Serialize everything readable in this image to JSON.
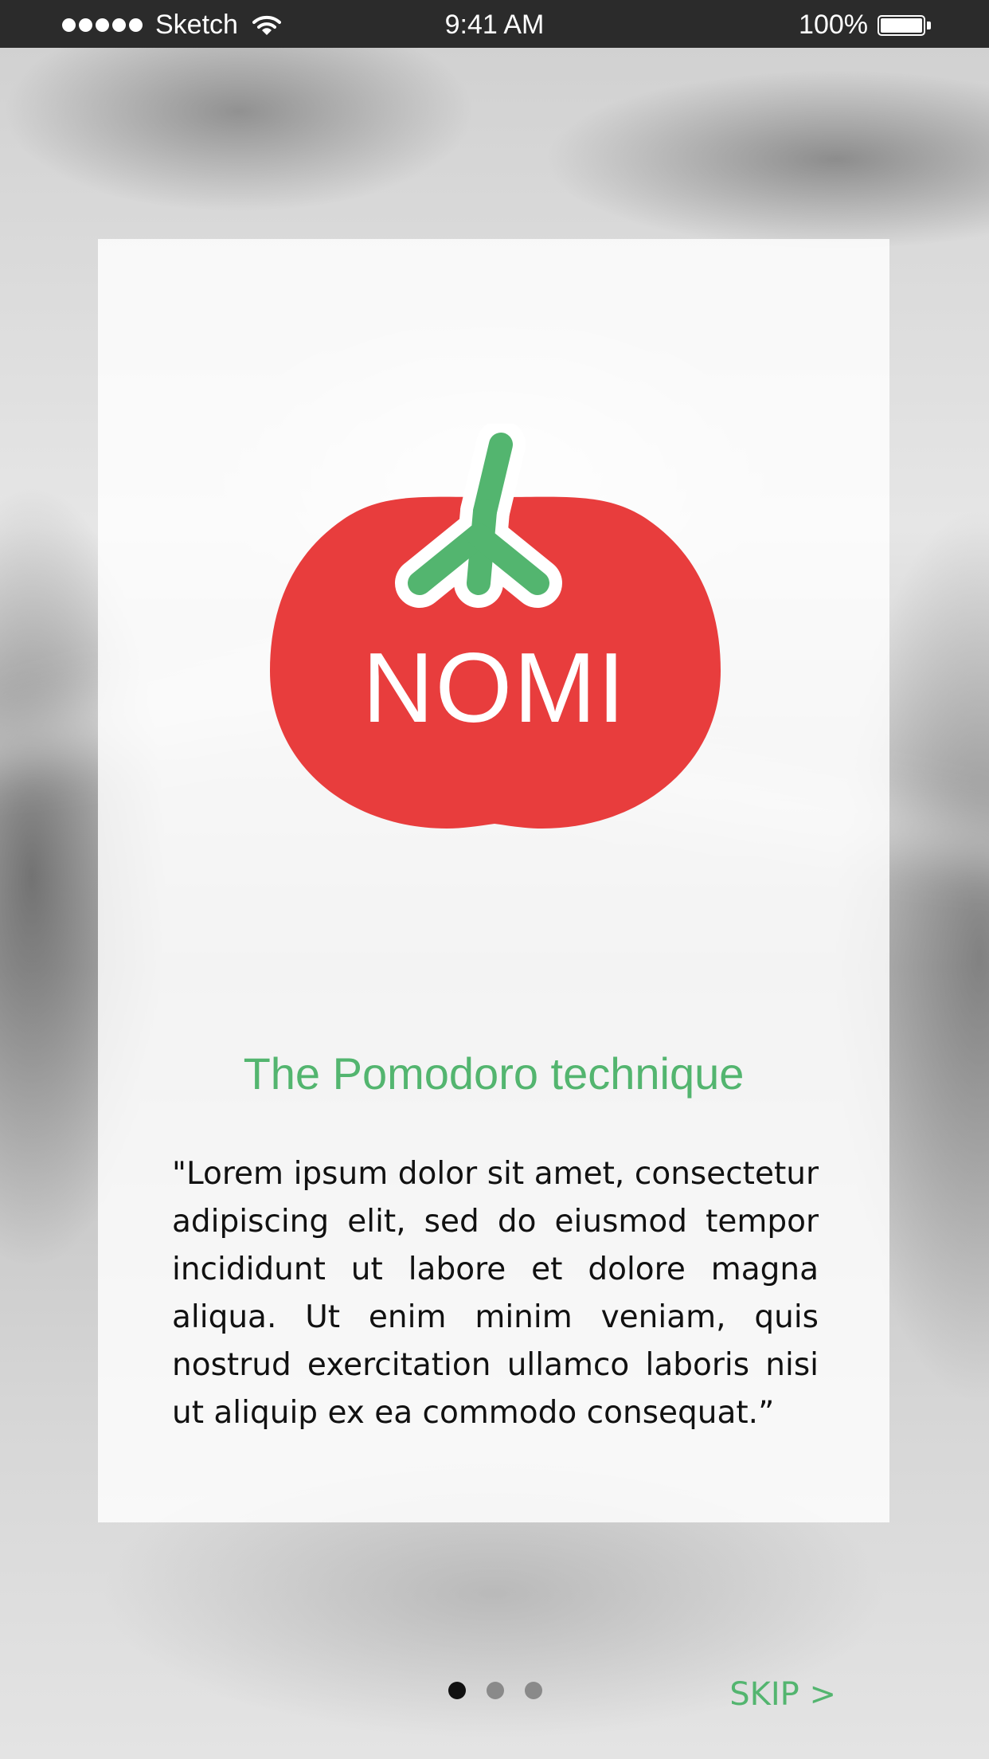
{
  "status_bar": {
    "carrier": "Sketch",
    "time": "9:41 AM",
    "battery_percent": "100%",
    "signal_icon": "signal-dots-icon",
    "wifi_icon": "wifi-icon",
    "battery_icon": "battery-icon"
  },
  "card": {
    "logo": {
      "text": "NOMI",
      "icon": "tomato-logo-icon",
      "colors": {
        "tomato": "#e83d3d",
        "stem": "#53b56f"
      }
    },
    "title": "The Pomodoro technique",
    "quote": "\"Lorem ipsum dolor sit amet, consectetur adipiscing elit, sed do eiusmod tempor incididunt ut labore et dolore magna aliqua. Ut enim minim veniam, quis nostrud exercitation ullamco laboris nisi ut aliquip ex ea commodo consequat.”"
  },
  "pager": {
    "total_pages": 3,
    "current_page": 1
  },
  "skip": {
    "label": "SKIP >"
  },
  "colors": {
    "accent": "#53b56f",
    "brand_red": "#e83d3d",
    "status_bar_bg": "#2b2b2b"
  }
}
